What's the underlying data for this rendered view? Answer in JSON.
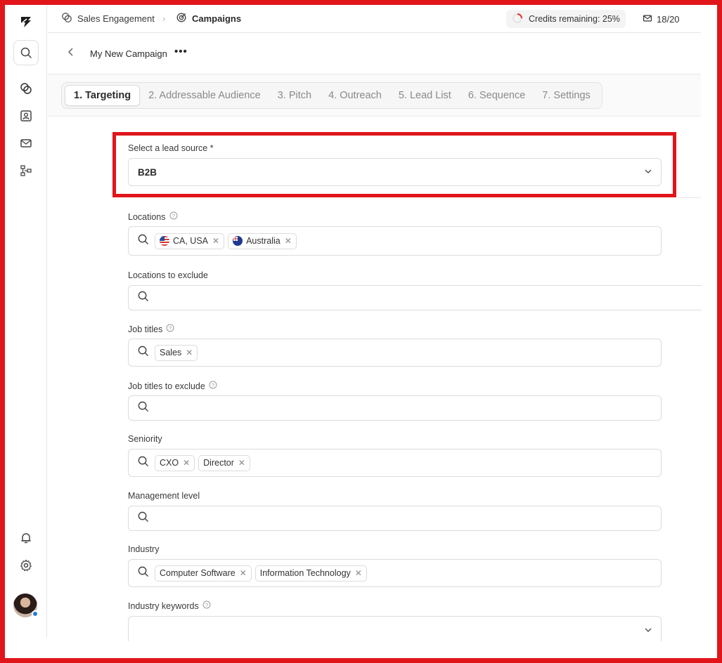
{
  "topbar": {
    "breadcrumb_1": "Sales Engagement",
    "breadcrumb_sep": "›",
    "breadcrumb_2": "Campaigns",
    "credits_label": "Credits remaining: 25%",
    "credits_fraction": 0.25,
    "mail_count": "18/20"
  },
  "campaign": {
    "title": "My New Campaign",
    "more": "•••"
  },
  "tabs": [
    {
      "label": "1. Targeting",
      "active": true
    },
    {
      "label": "2. Addressable Audience"
    },
    {
      "label": "3. Pitch"
    },
    {
      "label": "4. Outreach"
    },
    {
      "label": "5. Lead List"
    },
    {
      "label": "6. Sequence"
    },
    {
      "label": "7. Settings"
    }
  ],
  "form": {
    "lead_source": {
      "label": "Select a lead source *",
      "value": "B2B"
    },
    "locations": {
      "label": "Locations",
      "chips": [
        "CA, USA",
        "Australia"
      ]
    },
    "locations_exclude": {
      "label": "Locations to exclude"
    },
    "job_titles": {
      "label": "Job titles",
      "chips": [
        "Sales"
      ]
    },
    "job_titles_exclude": {
      "label": "Job titles to exclude"
    },
    "seniority": {
      "label": "Seniority",
      "chips": [
        "CXO",
        "Director"
      ]
    },
    "management_level": {
      "label": "Management level"
    },
    "industry": {
      "label": "Industry",
      "chips": [
        "Computer Software",
        "Information Technology"
      ]
    },
    "industry_keywords": {
      "label": "Industry keywords"
    }
  },
  "colors": {
    "accent_red": "#e0161b",
    "credits_ring": "#e8332b",
    "status_dot": "#2a7ad8"
  }
}
